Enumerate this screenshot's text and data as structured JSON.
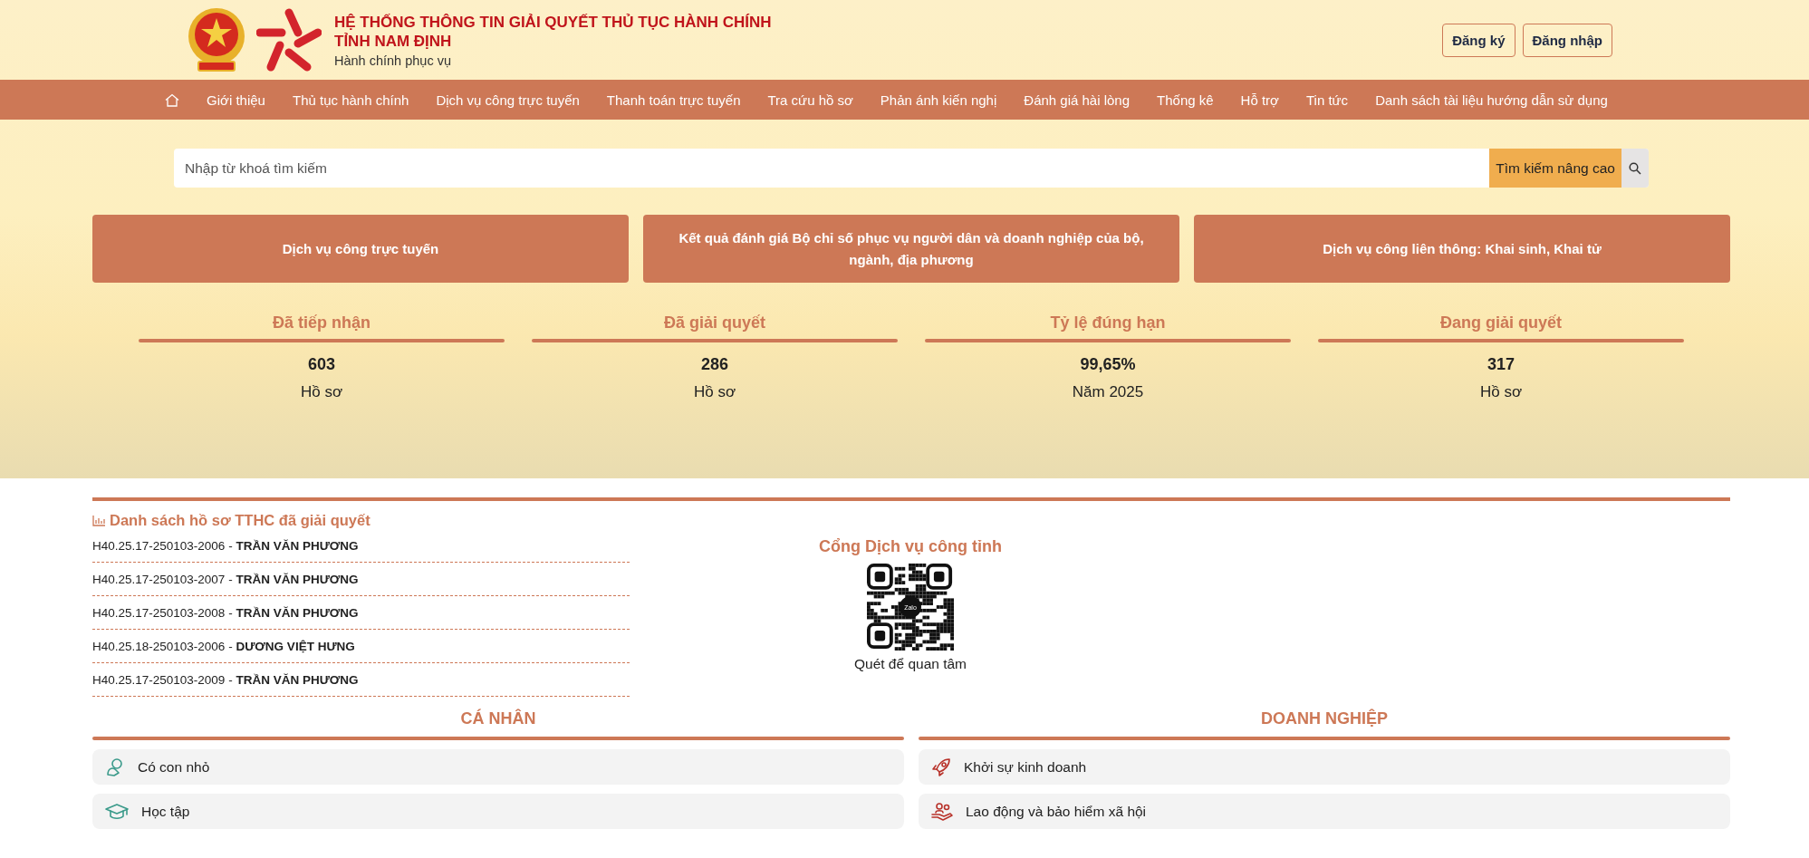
{
  "header": {
    "title_line1": "HỆ THỐNG THÔNG TIN GIẢI QUYẾT THỦ TỤC HÀNH CHÍNH",
    "title_line2": "TỈNH NAM ĐỊNH",
    "subtitle": "Hành chính phục vụ",
    "buttons": [
      "Đăng ký",
      "Đăng nhập"
    ]
  },
  "nav": {
    "items": [
      "Giới thiệu",
      "Thủ tục hành chính",
      "Dịch vụ công trực tuyến",
      "Thanh toán trực tuyến",
      "Tra cứu hồ sơ",
      "Phản ánh kiến nghị",
      "Đánh giá hài lòng",
      "Thống kê",
      "Hỗ trợ",
      "Tin tức",
      "Danh sách tài liệu hướng dẫn sử dụng"
    ]
  },
  "search": {
    "placeholder": "Nhập từ khoá tìm kiếm",
    "advanced_button": "Tìm kiếm nâng cao"
  },
  "cards": [
    "Dịch vụ công trực tuyến",
    "Kết quả đánh giá Bộ chỉ số phục vụ người dân và doanh nghiệp của bộ, ngành, địa phương",
    "Dịch vụ công liên thông: Khai sinh, Khai tử"
  ],
  "stats": [
    {
      "label": "Đã tiếp nhận",
      "value": "603",
      "unit": "Hồ sơ"
    },
    {
      "label": "Đã giải quyết",
      "value": "286",
      "unit": "Hồ sơ"
    },
    {
      "label": "Tỷ lệ đúng hạn",
      "value": "99,65%",
      "unit": "Năm 2025"
    },
    {
      "label": "Đang giải quyết",
      "value": "317",
      "unit": "Hồ sơ"
    }
  ],
  "resolved_list": {
    "title": "Danh sách hồ sơ TTHC đã giải quyết",
    "separator": "-",
    "rows": [
      {
        "code": "H40.25.17-250103-2006",
        "name": "TRẦN VĂN PHƯƠNG"
      },
      {
        "code": "H40.25.17-250103-2007",
        "name": "TRẦN VĂN PHƯƠNG"
      },
      {
        "code": "H40.25.17-250103-2008",
        "name": "TRẦN VĂN PHƯƠNG"
      },
      {
        "code": "H40.25.18-250103-2006",
        "name": "DƯƠNG VIỆT HƯNG"
      },
      {
        "code": "H40.25.17-250103-2009",
        "name": "TRẦN VĂN PHƯƠNG"
      }
    ]
  },
  "qr": {
    "title": "Cổng Dịch vụ công tỉnh",
    "badge": "Zalo",
    "caption": "Quét để quan tâm"
  },
  "sections": [
    {
      "title": "CÁ NHÂN",
      "items": [
        {
          "kind": "child",
          "label": "Có con nhỏ"
        },
        {
          "kind": "education",
          "label": "Học tập"
        }
      ]
    },
    {
      "title": "DOANH NGHIỆP",
      "items": [
        {
          "kind": "startup",
          "label": "Khởi sự kinh doanh"
        },
        {
          "kind": "labor",
          "label": "Lao động và bảo hiểm xã hội"
        }
      ]
    }
  ]
}
